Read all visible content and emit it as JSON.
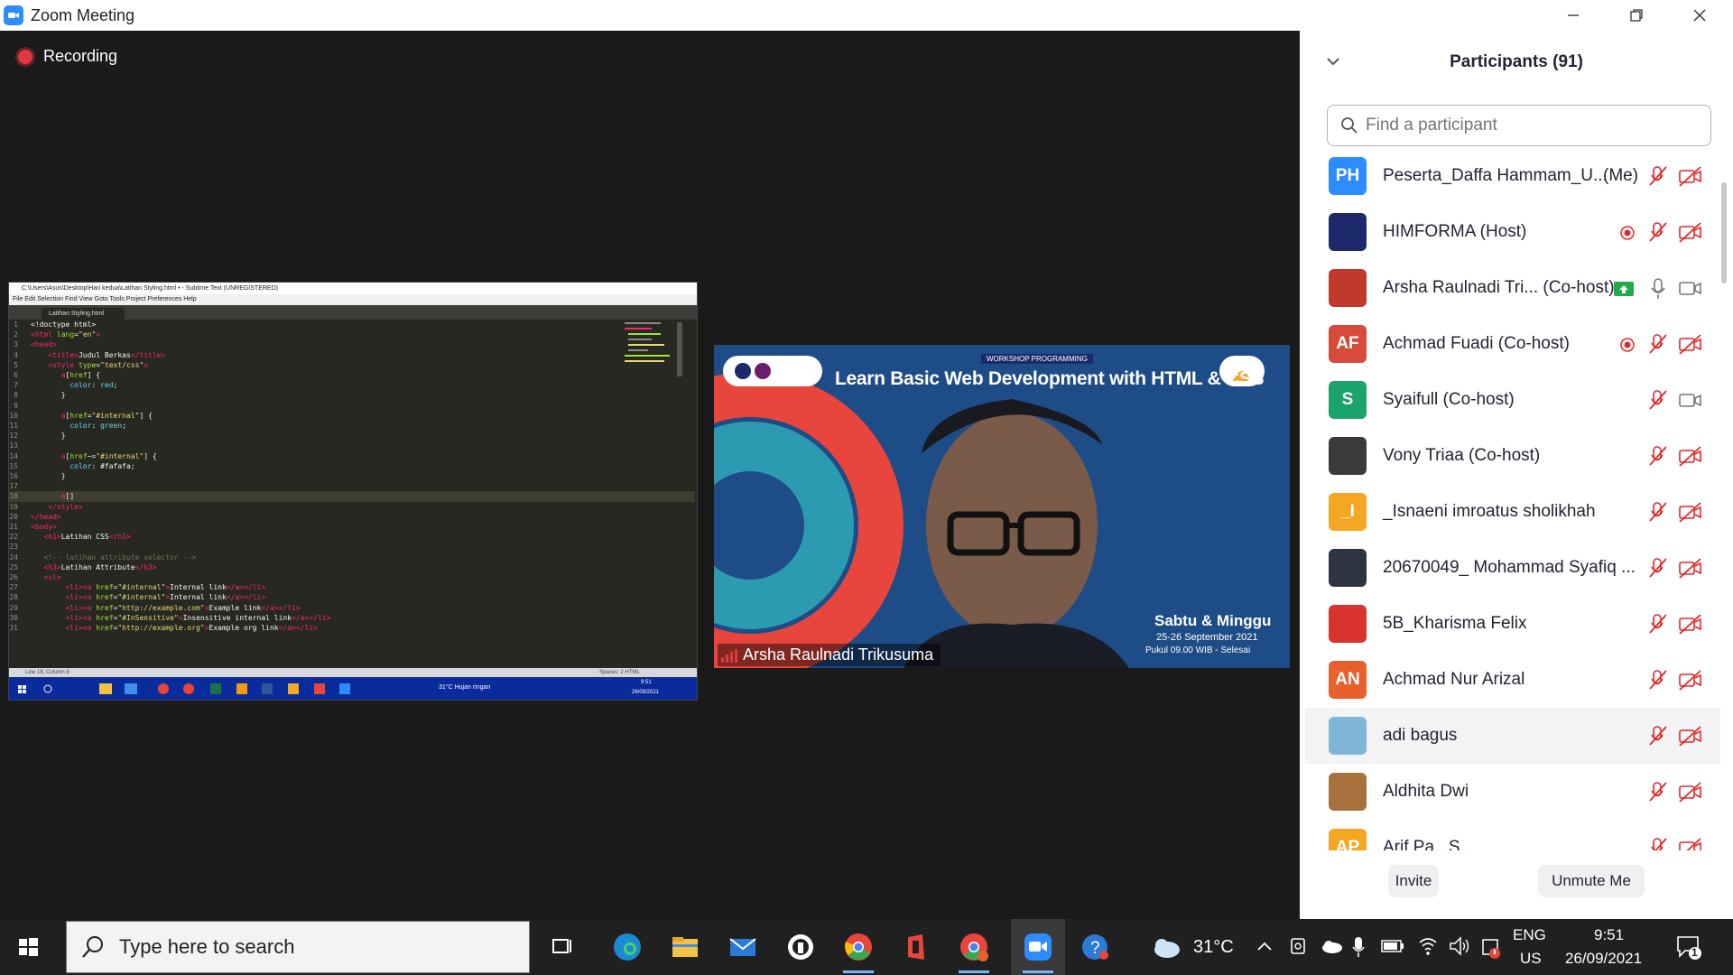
{
  "window": {
    "title": "Zoom Meeting",
    "brand_color": "#2d8cff"
  },
  "meeting": {
    "recording_label": "Recording",
    "speaker_name": "Arsha Raulnadi Trikusuma",
    "banner": {
      "title": "Learn Basic Web Development with HTML & CSS",
      "tag": "WORKSHOP PROGRAMMING",
      "days": "Sabtu & Minggu",
      "dates": "25-26 September 2021",
      "time": "Pukul 09.00 WIB - Selesai"
    },
    "share": {
      "window_title": "C:\\Users\\Asus\\Desktop\\Hari kedua\\Latihan Styling.html • - Sublime Text (UNREGISTERED)",
      "menu": "File  Edit  Selection  Find  View  Goto  Tools  Project  Preferences  Help",
      "tab": "Latihan Styling.html",
      "status": "Line 18, Column 8",
      "status_right": "Spaces: 2        HTML",
      "taskbar_weather": "31°C  Hujan ringan",
      "taskbar_time": "9:51",
      "taskbar_date": "26/09/2021"
    }
  },
  "participants": {
    "header": "Participants (91)",
    "search_placeholder": "Find a participant",
    "invite_label": "Invite",
    "unmute_label": "Unmute Me",
    "me_label": "(Me)",
    "list": [
      {
        "initials": "PH",
        "name": "Peserta_Daffa Hammam_U...",
        "color": "#2d8cff",
        "me": true
      },
      {
        "initials": "",
        "name": "HIMFORMA (Host)",
        "color": "#1c2a6b"
      },
      {
        "initials": "",
        "name": "Arsha Raulnadi Tri... (Co-host)",
        "color": "#c0392b"
      },
      {
        "initials": "AF",
        "name": "Achmad Fuadi (Co-host)",
        "color": "#d84a3a"
      },
      {
        "initials": "S",
        "name": "Syaifull (Co-host)",
        "color": "#1aa36b"
      },
      {
        "initials": "",
        "name": "Vony Triaa (Co-host)",
        "color": "#3b3b3b"
      },
      {
        "initials": "_I",
        "name": "_Isnaeni imroatus sholikhah",
        "color": "#f5a623"
      },
      {
        "initials": "",
        "name": "20670049_ Mohammad Syafiq ...",
        "color": "#2f3540"
      },
      {
        "initials": "",
        "name": "5B_Kharisma Felix",
        "color": "#d9332e"
      },
      {
        "initials": "AN",
        "name": "Achmad Nur Arizal",
        "color": "#e8612c"
      },
      {
        "initials": "",
        "name": "adi bagus",
        "color": "#7fb6d8"
      },
      {
        "initials": "",
        "name": "Aldhita Dwi",
        "color": "#a8703c"
      },
      {
        "initials": "AP",
        "name": "Arif Pa...S...",
        "color": "#f5a623"
      }
    ]
  },
  "taskbar": {
    "search_placeholder": "Type here to search",
    "temperature": "31°C",
    "language_top": "ENG",
    "language_bottom": "US",
    "time": "9:51",
    "date": "26/09/2021",
    "notification_count": "1"
  }
}
